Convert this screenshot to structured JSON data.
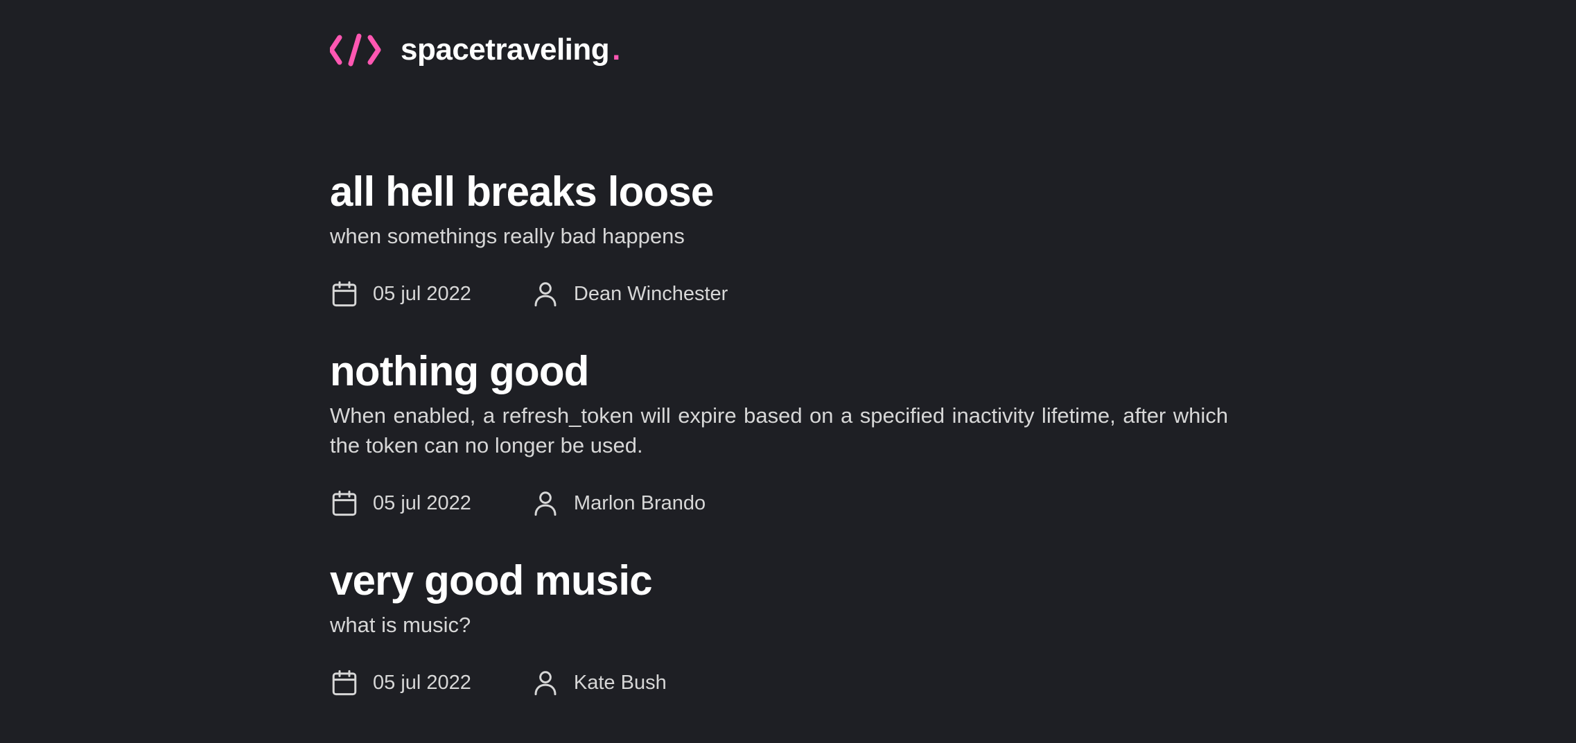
{
  "header": {
    "logo_icon": "code-brackets-icon",
    "brand_name": "spacetraveling",
    "brand_dot": ".",
    "accent_color": "#ff57b2"
  },
  "posts": [
    {
      "title": "all hell breaks loose",
      "subtitle": "when somethings really bad happens",
      "date": "05 jul 2022",
      "author": "Dean Winchester"
    },
    {
      "title": "nothing good",
      "subtitle": "When enabled, a refresh_token will expire based on a specified inactivity lifetime, after which the token can no longer be used.",
      "date": "05 jul 2022",
      "author": "Marlon Brando"
    },
    {
      "title": "very good music",
      "subtitle": "what is music?",
      "date": "05 jul 2022",
      "author": "Kate Bush"
    }
  ],
  "icons": {
    "date": "calendar-icon",
    "author": "user-icon"
  },
  "colors": {
    "background": "#1e1f24",
    "heading": "#ffffff",
    "body_text": "#d7d7d7"
  }
}
